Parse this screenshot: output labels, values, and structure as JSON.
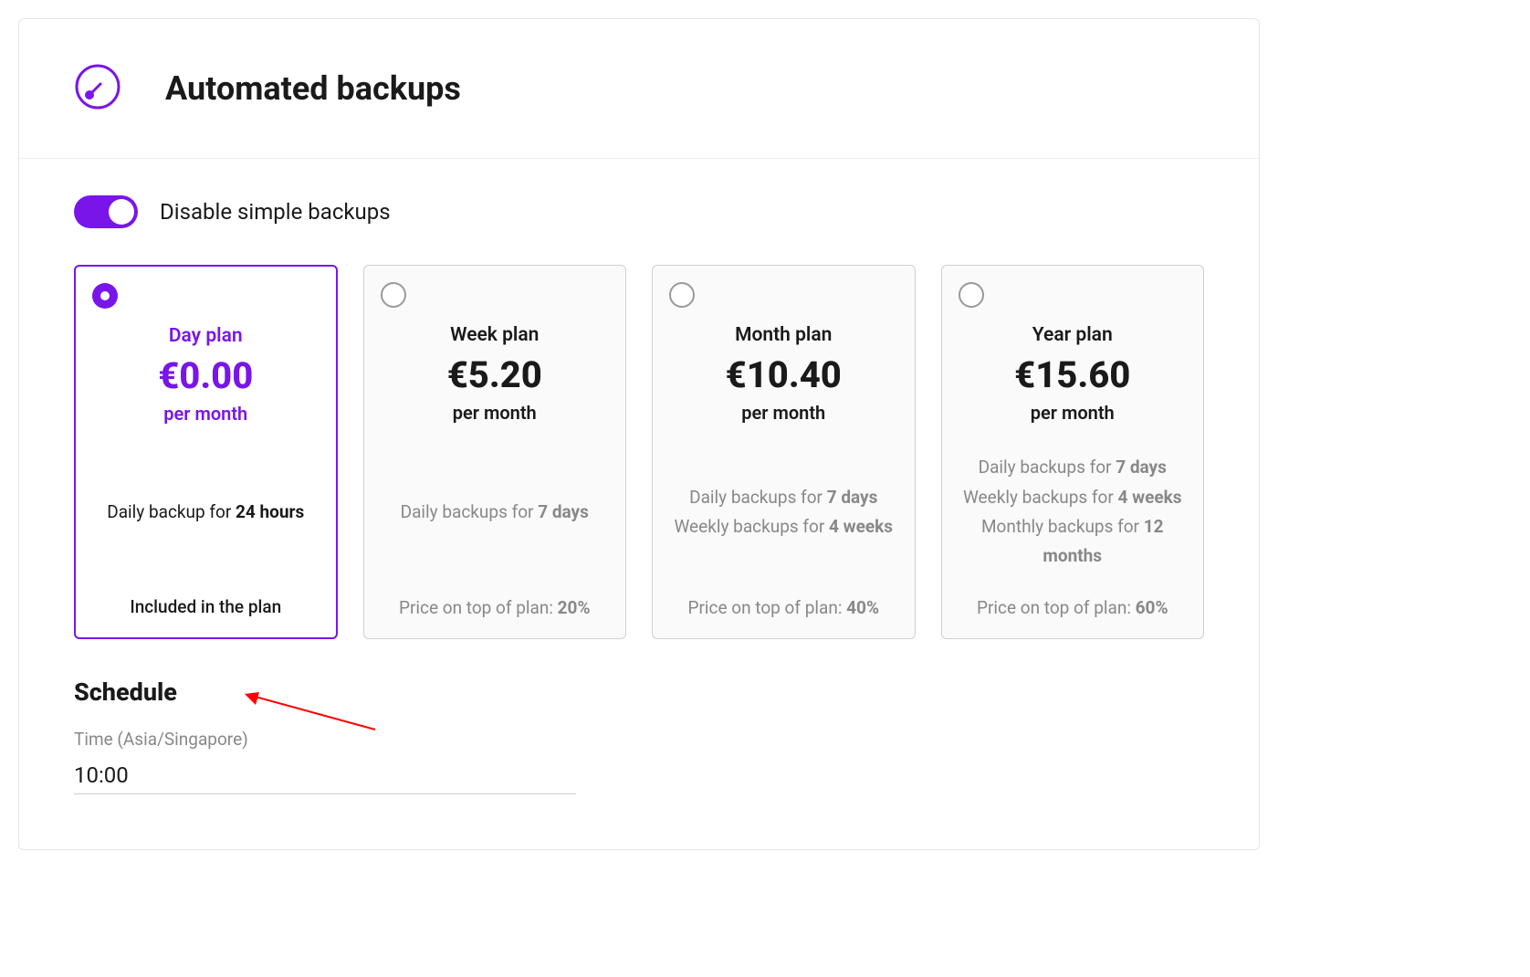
{
  "header": {
    "title": "Automated backups"
  },
  "toggle": {
    "label": "Disable simple backups",
    "enabled": true
  },
  "plans": [
    {
      "name": "Day plan",
      "price": "€0.00",
      "period": "per month",
      "feature1_prefix": "Daily backup for ",
      "feature1_bold": "24 hours",
      "footer_text": "Included in the plan",
      "selected": true
    },
    {
      "name": "Week plan",
      "price": "€5.20",
      "period": "per month",
      "feature1_prefix": "Daily backups for ",
      "feature1_bold": "7 days",
      "footer_prefix": "Price on top of plan: ",
      "footer_bold": "20%"
    },
    {
      "name": "Month plan",
      "price": "€10.40",
      "period": "per month",
      "feature1_prefix": "Daily backups for ",
      "feature1_bold": "7 days",
      "feature2_prefix": "Weekly backups for ",
      "feature2_bold": "4 weeks",
      "footer_prefix": "Price on top of plan: ",
      "footer_bold": "40%"
    },
    {
      "name": "Year plan",
      "price": "€15.60",
      "period": "per month",
      "feature1_prefix": "Daily backups for ",
      "feature1_bold": "7 days",
      "feature2_prefix": "Weekly backups for ",
      "feature2_bold": "4 weeks",
      "feature3_prefix": "Monthly backups for ",
      "feature3_bold": "12 months",
      "footer_prefix": "Price on top of plan: ",
      "footer_bold": "60%"
    }
  ],
  "schedule": {
    "title": "Schedule",
    "label": "Time (Asia/Singapore)",
    "value": "10:00"
  },
  "colors": {
    "accent": "#7915e9"
  }
}
